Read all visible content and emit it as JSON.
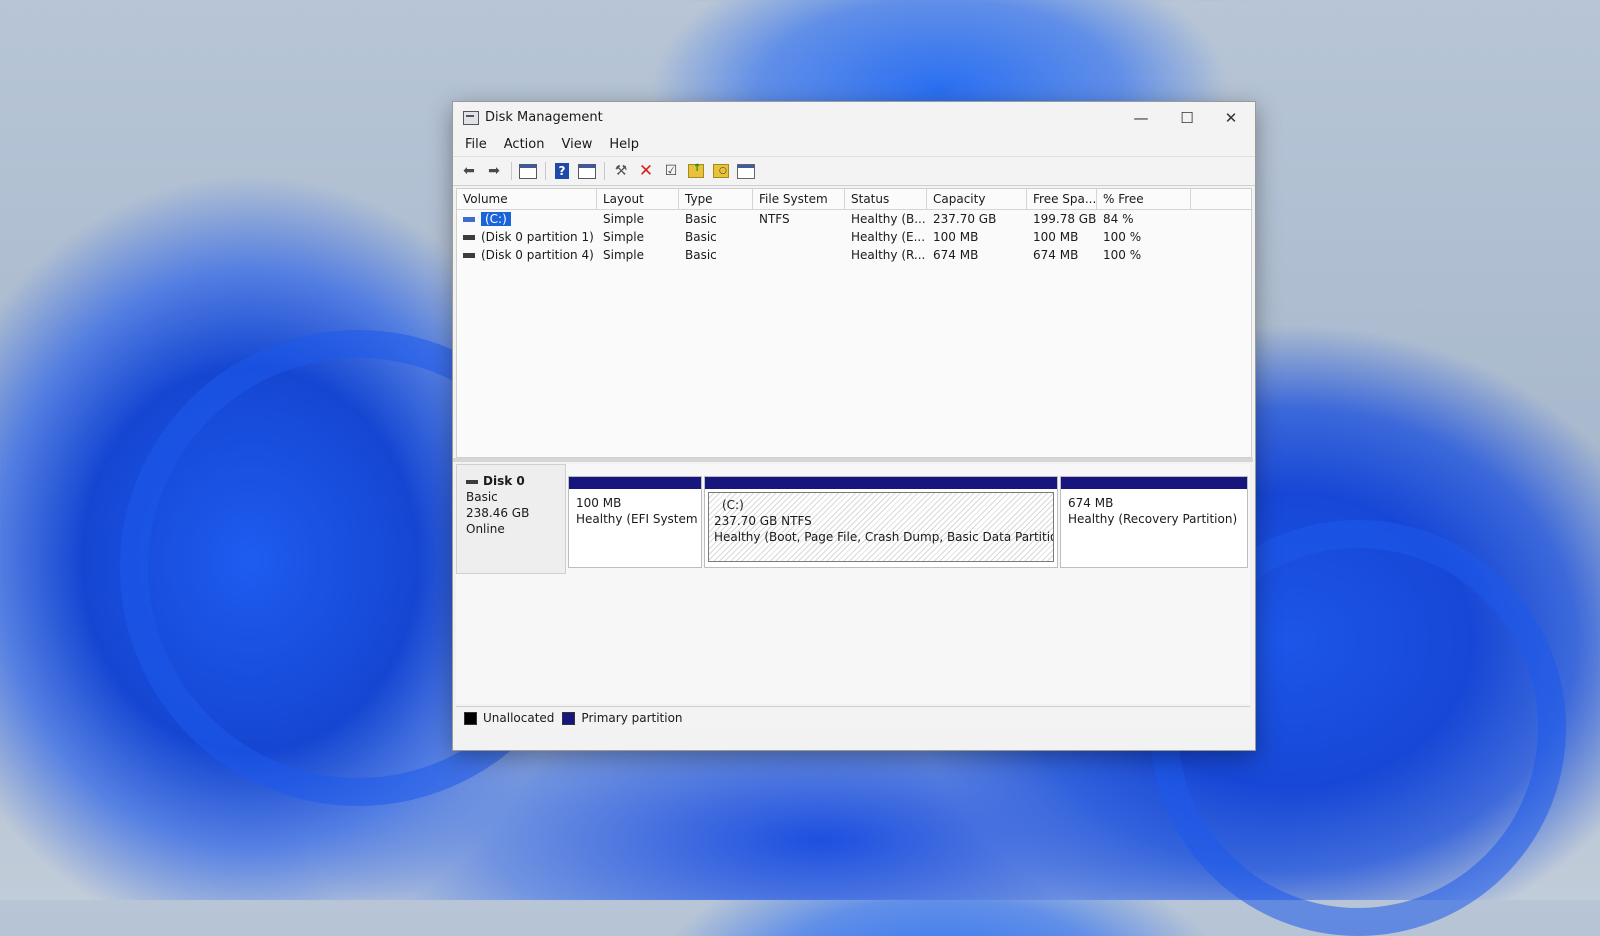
{
  "window": {
    "title": "Disk Management",
    "controls": {
      "minimize": "—",
      "maximize": "☐",
      "close": "✕"
    }
  },
  "menu": [
    "File",
    "Action",
    "View",
    "Help"
  ],
  "toolbar_icons": [
    "back-arrow-icon",
    "forward-arrow-icon",
    "console-tree-icon",
    "help-icon",
    "properties-window-icon",
    "connect-icon",
    "delete-icon",
    "checklist-icon",
    "up-folder-icon",
    "search-folder-icon",
    "settings-window-icon"
  ],
  "volume_list": {
    "columns": [
      "Volume",
      "Layout",
      "Type",
      "File System",
      "Status",
      "Capacity",
      "Free Spa...",
      "% Free"
    ],
    "rows": [
      {
        "volume": "(C:)",
        "layout": "Simple",
        "type": "Basic",
        "fs": "NTFS",
        "status": "Healthy (B...",
        "capacity": "237.70 GB",
        "free": "199.78 GB",
        "pct": "84 %",
        "selected": true
      },
      {
        "volume": "(Disk 0 partition 1)",
        "layout": "Simple",
        "type": "Basic",
        "fs": "",
        "status": "Healthy (E...",
        "capacity": "100 MB",
        "free": "100 MB",
        "pct": "100 %"
      },
      {
        "volume": "(Disk 0 partition 4)",
        "layout": "Simple",
        "type": "Basic",
        "fs": "",
        "status": "Healthy (R...",
        "capacity": "674 MB",
        "free": "674 MB",
        "pct": "100 %"
      }
    ]
  },
  "disk": {
    "name": "Disk 0",
    "type": "Basic",
    "size": "238.46 GB",
    "state": "Online",
    "partitions": [
      {
        "label": "",
        "size": "100 MB",
        "status": "Healthy (EFI System P"
      },
      {
        "label": "(C:)",
        "size": "237.70 GB NTFS",
        "status": "Healthy (Boot, Page File, Crash Dump, Basic Data Partition)"
      },
      {
        "label": "",
        "size": "674 MB",
        "status": "Healthy (Recovery Partition)"
      }
    ]
  },
  "legend": [
    {
      "label": "Unallocated",
      "color": "#000000"
    },
    {
      "label": "Primary partition",
      "color": "#16167e"
    }
  ],
  "colors": {
    "accent": "#1b63d8",
    "primary_partition": "#16167e"
  }
}
